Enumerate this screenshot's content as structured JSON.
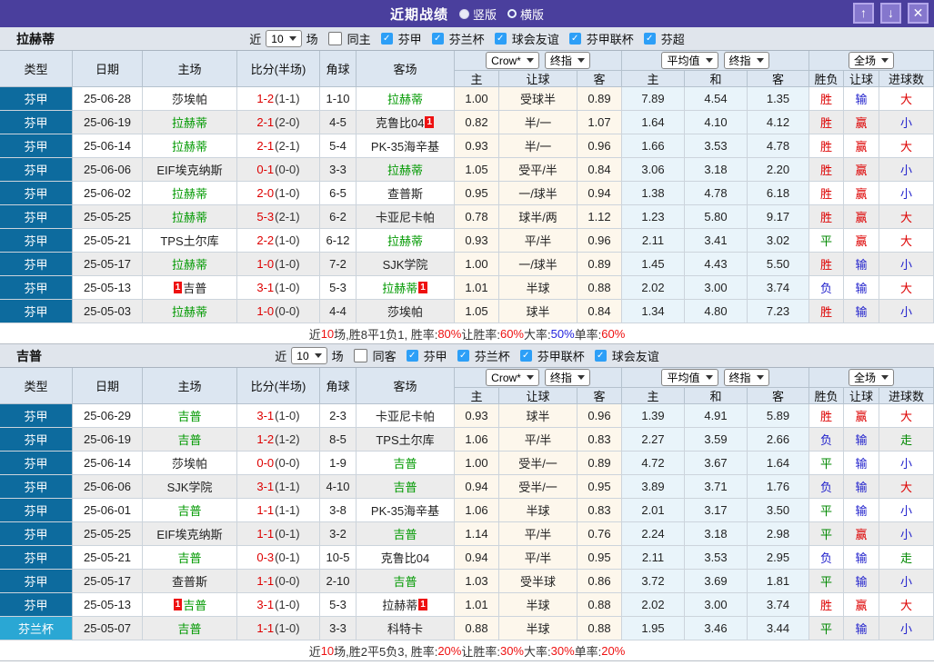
{
  "titlebar": {
    "title": "近期战绩",
    "modes": [
      {
        "label": "竖版",
        "selected": true
      },
      {
        "label": "横版",
        "selected": false
      }
    ],
    "buttons": [
      {
        "name": "move-up-button",
        "icon": "up-arrow-icon",
        "glyph": "↑"
      },
      {
        "name": "move-down-button",
        "icon": "down-arrow-icon",
        "glyph": "↓"
      },
      {
        "name": "close-button",
        "icon": "close-icon",
        "glyph": "✕"
      }
    ]
  },
  "colors": {
    "titlebar": "#4a3f9d",
    "titlebar_button": "#8577cd",
    "league_cell": "#0d6b9e",
    "cup_cell": "#2aa7d4",
    "team_highlight_green": "#009900",
    "score_red": "#dd0000",
    "win_red": "#dd0000",
    "lose_blue": "#2222cc",
    "draw_green": "#008800",
    "checkbox_blue": "#2d9ff7"
  },
  "table_headers": {
    "left": [
      "类型",
      "日期",
      "主场",
      "比分(半场)",
      "角球",
      "客场"
    ],
    "handicap_dropdowns": [
      "Crow*",
      "终指"
    ],
    "handicap_cols": [
      "主",
      "让球",
      "客"
    ],
    "avg_dropdowns": [
      "平均值",
      "终指"
    ],
    "avg_cols": [
      "主",
      "和",
      "客"
    ],
    "result_dropdown": "全场",
    "result_cols": [
      "胜负",
      "让球",
      "进球数"
    ]
  },
  "sections": [
    {
      "team": "拉赫蒂",
      "filter": {
        "prefix": "近",
        "count": "10",
        "suffix": "场",
        "same_label": "同主",
        "same_checked": false,
        "leagues": [
          {
            "label": "芬甲",
            "checked": true
          },
          {
            "label": "芬兰杯",
            "checked": true
          },
          {
            "label": "球会友谊",
            "checked": true
          },
          {
            "label": "芬甲联杯",
            "checked": true
          },
          {
            "label": "芬超",
            "checked": true
          }
        ]
      },
      "rows": [
        {
          "league": "芬甲",
          "date": "25-06-28",
          "home": "莎埃帕",
          "home_green": false,
          "home_badge": "",
          "score": "1-2",
          "half": "(1-1)",
          "corner": "1-10",
          "away": "拉赫蒂",
          "away_green": true,
          "away_badge": "",
          "hcp": [
            "1.00",
            "受球半",
            "0.89"
          ],
          "avg": [
            "7.89",
            "4.54",
            "1.35"
          ],
          "res": [
            "胜",
            "输",
            "大"
          ]
        },
        {
          "league": "芬甲",
          "date": "25-06-19",
          "home": "拉赫蒂",
          "home_green": true,
          "home_badge": "",
          "score": "2-1",
          "half": "(2-0)",
          "corner": "4-5",
          "away": "克鲁比04",
          "away_green": false,
          "away_badge": "1",
          "hcp": [
            "0.82",
            "半/一",
            "1.07"
          ],
          "avg": [
            "1.64",
            "4.10",
            "4.12"
          ],
          "res": [
            "胜",
            "赢",
            "小"
          ]
        },
        {
          "league": "芬甲",
          "date": "25-06-14",
          "home": "拉赫蒂",
          "home_green": true,
          "home_badge": "",
          "score": "2-1",
          "half": "(2-1)",
          "corner": "5-4",
          "away": "PK-35海辛基",
          "away_green": false,
          "away_badge": "",
          "hcp": [
            "0.93",
            "半/一",
            "0.96"
          ],
          "avg": [
            "1.66",
            "3.53",
            "4.78"
          ],
          "res": [
            "胜",
            "赢",
            "大"
          ]
        },
        {
          "league": "芬甲",
          "date": "25-06-06",
          "home": "EIF埃克纳斯",
          "home_green": false,
          "home_badge": "",
          "score": "0-1",
          "half": "(0-0)",
          "corner": "3-3",
          "away": "拉赫蒂",
          "away_green": true,
          "away_badge": "",
          "hcp": [
            "1.05",
            "受平/半",
            "0.84"
          ],
          "avg": [
            "3.06",
            "3.18",
            "2.20"
          ],
          "res": [
            "胜",
            "赢",
            "小"
          ]
        },
        {
          "league": "芬甲",
          "date": "25-06-02",
          "home": "拉赫蒂",
          "home_green": true,
          "home_badge": "",
          "score": "2-0",
          "half": "(1-0)",
          "corner": "6-5",
          "away": "查普斯",
          "away_green": false,
          "away_badge": "",
          "hcp": [
            "0.95",
            "一/球半",
            "0.94"
          ],
          "avg": [
            "1.38",
            "4.78",
            "6.18"
          ],
          "res": [
            "胜",
            "赢",
            "小"
          ]
        },
        {
          "league": "芬甲",
          "date": "25-05-25",
          "home": "拉赫蒂",
          "home_green": true,
          "home_badge": "",
          "score": "5-3",
          "half": "(2-1)",
          "corner": "6-2",
          "away": "卡亚尼卡帕",
          "away_green": false,
          "away_badge": "",
          "hcp": [
            "0.78",
            "球半/两",
            "1.12"
          ],
          "avg": [
            "1.23",
            "5.80",
            "9.17"
          ],
          "res": [
            "胜",
            "赢",
            "大"
          ]
        },
        {
          "league": "芬甲",
          "date": "25-05-21",
          "home": "TPS土尔库",
          "home_green": false,
          "home_badge": "",
          "score": "2-2",
          "half": "(1-0)",
          "corner": "6-12",
          "away": "拉赫蒂",
          "away_green": true,
          "away_badge": "",
          "hcp": [
            "0.93",
            "平/半",
            "0.96"
          ],
          "avg": [
            "2.11",
            "3.41",
            "3.02"
          ],
          "res": [
            "平",
            "赢",
            "大"
          ]
        },
        {
          "league": "芬甲",
          "date": "25-05-17",
          "home": "拉赫蒂",
          "home_green": true,
          "home_badge": "",
          "score": "1-0",
          "half": "(1-0)",
          "corner": "7-2",
          "away": "SJK学院",
          "away_green": false,
          "away_badge": "",
          "hcp": [
            "1.00",
            "一/球半",
            "0.89"
          ],
          "avg": [
            "1.45",
            "4.43",
            "5.50"
          ],
          "res": [
            "胜",
            "输",
            "小"
          ]
        },
        {
          "league": "芬甲",
          "date": "25-05-13",
          "home": "吉普",
          "home_green": false,
          "home_badge": "1",
          "score": "3-1",
          "half": "(1-0)",
          "corner": "5-3",
          "away": "拉赫蒂",
          "away_green": true,
          "away_badge": "1",
          "hcp": [
            "1.01",
            "半球",
            "0.88"
          ],
          "avg": [
            "2.02",
            "3.00",
            "3.74"
          ],
          "res": [
            "负",
            "输",
            "大"
          ]
        },
        {
          "league": "芬甲",
          "date": "25-05-03",
          "home": "拉赫蒂",
          "home_green": true,
          "home_badge": "",
          "score": "1-0",
          "half": "(0-0)",
          "corner": "4-4",
          "away": "莎埃帕",
          "away_green": false,
          "away_badge": "",
          "hcp": [
            "1.05",
            "球半",
            "0.84"
          ],
          "avg": [
            "1.34",
            "4.80",
            "7.23"
          ],
          "res": [
            "胜",
            "输",
            "小"
          ]
        }
      ],
      "summary": [
        {
          "t": "近",
          "c": "k"
        },
        {
          "t": "10",
          "c": "r"
        },
        {
          "t": "场,胜8平1负1, 胜率:",
          "c": "k"
        },
        {
          "t": "80%",
          "c": "r"
        },
        {
          "t": " 让胜率:",
          "c": "k"
        },
        {
          "t": "60%",
          "c": "r"
        },
        {
          "t": " 大率:",
          "c": "k"
        },
        {
          "t": "50%",
          "c": "b"
        },
        {
          "t": " 单率:",
          "c": "k"
        },
        {
          "t": "60%",
          "c": "r"
        }
      ]
    },
    {
      "team": "吉普",
      "filter": {
        "prefix": "近",
        "count": "10",
        "suffix": "场",
        "same_label": "同客",
        "same_checked": false,
        "leagues": [
          {
            "label": "芬甲",
            "checked": true
          },
          {
            "label": "芬兰杯",
            "checked": true
          },
          {
            "label": "芬甲联杯",
            "checked": true
          },
          {
            "label": "球会友谊",
            "checked": true
          }
        ]
      },
      "rows": [
        {
          "league": "芬甲",
          "date": "25-06-29",
          "home": "吉普",
          "home_green": true,
          "home_badge": "",
          "score": "3-1",
          "half": "(1-0)",
          "corner": "2-3",
          "away": "卡亚尼卡帕",
          "away_green": false,
          "away_badge": "",
          "hcp": [
            "0.93",
            "球半",
            "0.96"
          ],
          "avg": [
            "1.39",
            "4.91",
            "5.89"
          ],
          "res": [
            "胜",
            "赢",
            "大"
          ]
        },
        {
          "league": "芬甲",
          "date": "25-06-19",
          "home": "吉普",
          "home_green": true,
          "home_badge": "",
          "score": "1-2",
          "half": "(1-2)",
          "corner": "8-5",
          "away": "TPS土尔库",
          "away_green": false,
          "away_badge": "",
          "hcp": [
            "1.06",
            "平/半",
            "0.83"
          ],
          "avg": [
            "2.27",
            "3.59",
            "2.66"
          ],
          "res": [
            "负",
            "输",
            "走"
          ]
        },
        {
          "league": "芬甲",
          "date": "25-06-14",
          "home": "莎埃帕",
          "home_green": false,
          "home_badge": "",
          "score": "0-0",
          "half": "(0-0)",
          "corner": "1-9",
          "away": "吉普",
          "away_green": true,
          "away_badge": "",
          "hcp": [
            "1.00",
            "受半/一",
            "0.89"
          ],
          "avg": [
            "4.72",
            "3.67",
            "1.64"
          ],
          "res": [
            "平",
            "输",
            "小"
          ]
        },
        {
          "league": "芬甲",
          "date": "25-06-06",
          "home": "SJK学院",
          "home_green": false,
          "home_badge": "",
          "score": "3-1",
          "half": "(1-1)",
          "corner": "4-10",
          "away": "吉普",
          "away_green": true,
          "away_badge": "",
          "hcp": [
            "0.94",
            "受半/一",
            "0.95"
          ],
          "avg": [
            "3.89",
            "3.71",
            "1.76"
          ],
          "res": [
            "负",
            "输",
            "大"
          ]
        },
        {
          "league": "芬甲",
          "date": "25-06-01",
          "home": "吉普",
          "home_green": true,
          "home_badge": "",
          "score": "1-1",
          "half": "(1-1)",
          "corner": "3-8",
          "away": "PK-35海辛基",
          "away_green": false,
          "away_badge": "",
          "hcp": [
            "1.06",
            "半球",
            "0.83"
          ],
          "avg": [
            "2.01",
            "3.17",
            "3.50"
          ],
          "res": [
            "平",
            "输",
            "小"
          ]
        },
        {
          "league": "芬甲",
          "date": "25-05-25",
          "home": "EIF埃克纳斯",
          "home_green": false,
          "home_badge": "",
          "score": "1-1",
          "half": "(0-1)",
          "corner": "3-2",
          "away": "吉普",
          "away_green": true,
          "away_badge": "",
          "hcp": [
            "1.14",
            "平/半",
            "0.76"
          ],
          "avg": [
            "2.24",
            "3.18",
            "2.98"
          ],
          "res": [
            "平",
            "赢",
            "小"
          ]
        },
        {
          "league": "芬甲",
          "date": "25-05-21",
          "home": "吉普",
          "home_green": true,
          "home_badge": "",
          "score": "0-3",
          "half": "(0-1)",
          "corner": "10-5",
          "away": "克鲁比04",
          "away_green": false,
          "away_badge": "",
          "hcp": [
            "0.94",
            "平/半",
            "0.95"
          ],
          "avg": [
            "2.11",
            "3.53",
            "2.95"
          ],
          "res": [
            "负",
            "输",
            "走"
          ]
        },
        {
          "league": "芬甲",
          "date": "25-05-17",
          "home": "查普斯",
          "home_green": false,
          "home_badge": "",
          "score": "1-1",
          "half": "(0-0)",
          "corner": "2-10",
          "away": "吉普",
          "away_green": true,
          "away_badge": "",
          "hcp": [
            "1.03",
            "受半球",
            "0.86"
          ],
          "avg": [
            "3.72",
            "3.69",
            "1.81"
          ],
          "res": [
            "平",
            "输",
            "小"
          ]
        },
        {
          "league": "芬甲",
          "date": "25-05-13",
          "home": "吉普",
          "home_green": true,
          "home_badge": "1",
          "score": "3-1",
          "half": "(1-0)",
          "corner": "5-3",
          "away": "拉赫蒂",
          "away_green": false,
          "away_badge": "1",
          "hcp": [
            "1.01",
            "半球",
            "0.88"
          ],
          "avg": [
            "2.02",
            "3.00",
            "3.74"
          ],
          "res": [
            "胜",
            "赢",
            "大"
          ]
        },
        {
          "league": "芬兰杯",
          "date": "25-05-07",
          "home": "吉普",
          "home_green": true,
          "home_badge": "",
          "score": "1-1",
          "half": "(1-0)",
          "corner": "3-3",
          "away": "科特卡",
          "away_green": false,
          "away_badge": "",
          "hcp": [
            "0.88",
            "半球",
            "0.88"
          ],
          "avg": [
            "1.95",
            "3.46",
            "3.44"
          ],
          "res": [
            "平",
            "输",
            "小"
          ]
        }
      ],
      "summary": [
        {
          "t": "近",
          "c": "k"
        },
        {
          "t": "10",
          "c": "r"
        },
        {
          "t": "场,胜2平5负3, 胜率:",
          "c": "k"
        },
        {
          "t": "20%",
          "c": "r"
        },
        {
          "t": " 让胜率:",
          "c": "k"
        },
        {
          "t": "30%",
          "c": "r"
        },
        {
          "t": " 大率:",
          "c": "k"
        },
        {
          "t": "30%",
          "c": "r"
        },
        {
          "t": " 单率:",
          "c": "k"
        },
        {
          "t": "20%",
          "c": "r"
        }
      ]
    }
  ]
}
